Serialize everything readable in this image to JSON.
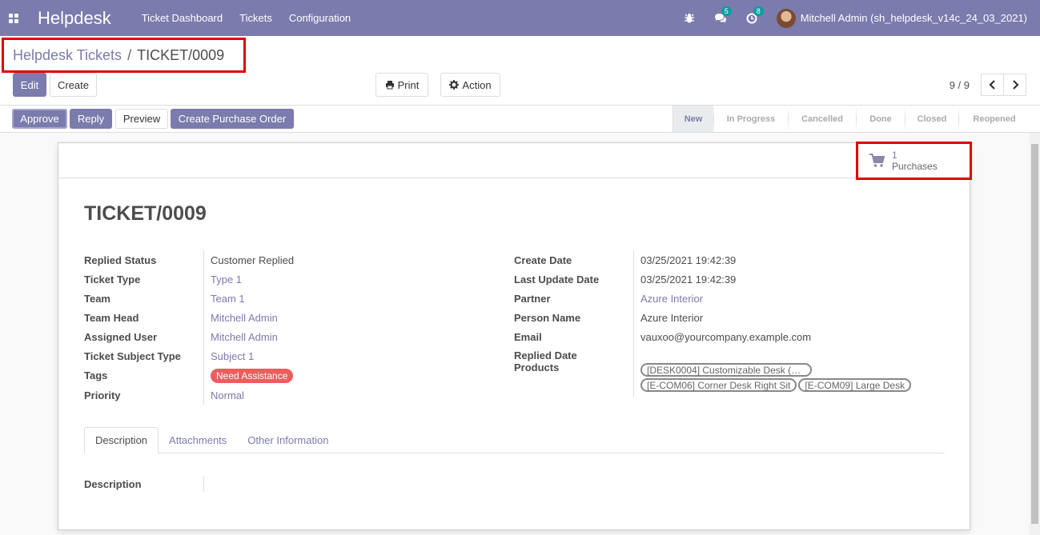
{
  "nav": {
    "brand": "Helpdesk",
    "menu": [
      "Ticket Dashboard",
      "Tickets",
      "Configuration"
    ],
    "chat_badge": "5",
    "activity_badge": "8",
    "user": "Mitchell Admin (sh_helpdesk_v14c_24_03_2021)"
  },
  "breadcrumb": {
    "parent": "Helpdesk Tickets",
    "separator": "/",
    "current": "TICKET/0009"
  },
  "toolbar": {
    "edit": "Edit",
    "create": "Create",
    "print": "Print",
    "action": "Action"
  },
  "pager": {
    "value": "9 / 9"
  },
  "statusbar": {
    "buttons": [
      "Approve",
      "Reply",
      "Preview",
      "Create Purchase Order"
    ],
    "stages": [
      "New",
      "In Progress",
      "Cancelled",
      "Done",
      "Closed",
      "Reopened"
    ],
    "active_stage": "New"
  },
  "smart_button": {
    "count": "1",
    "label": "Purchases"
  },
  "record": {
    "title": "TICKET/0009",
    "left_fields": [
      {
        "label": "Replied Status",
        "value": "Customer Replied",
        "type": "text"
      },
      {
        "label": "Ticket Type",
        "value": "Type 1",
        "type": "link"
      },
      {
        "label": "Team",
        "value": "Team 1",
        "type": "link"
      },
      {
        "label": "Team Head",
        "value": "Mitchell Admin",
        "type": "link"
      },
      {
        "label": "Assigned User",
        "value": "Mitchell Admin",
        "type": "link"
      },
      {
        "label": "Ticket Subject Type",
        "value": "Subject 1",
        "type": "link"
      },
      {
        "label": "Tags",
        "value": "Need Assistance",
        "type": "tag"
      },
      {
        "label": "Priority",
        "value": "Normal",
        "type": "link"
      }
    ],
    "right_fields": [
      {
        "label": "Create Date",
        "value": "03/25/2021 19:42:39",
        "type": "text"
      },
      {
        "label": "Last Update Date",
        "value": "03/25/2021 19:42:39",
        "type": "text"
      },
      {
        "label": "Partner",
        "value": "Azure Interior",
        "type": "link"
      },
      {
        "label": "Person Name",
        "value": "Azure Interior",
        "type": "text"
      },
      {
        "label": "Email",
        "value": "vauxoo@yourcompany.example.com",
        "type": "text"
      },
      {
        "label": "Replied Date",
        "value": "",
        "type": "text"
      }
    ],
    "products_label": "Products",
    "products": [
      "[DESK0004] Customizable Desk (…",
      "[E-COM06] Corner Desk Right Sit",
      "[E-COM09] Large Desk"
    ]
  },
  "tabs": [
    "Description",
    "Attachments",
    "Other Information"
  ],
  "description_label": "Description",
  "colors": {
    "primary": "#7c7bad",
    "highlight": "#e20000",
    "tag": "#ec5e5e",
    "badge": "#00a09d"
  }
}
